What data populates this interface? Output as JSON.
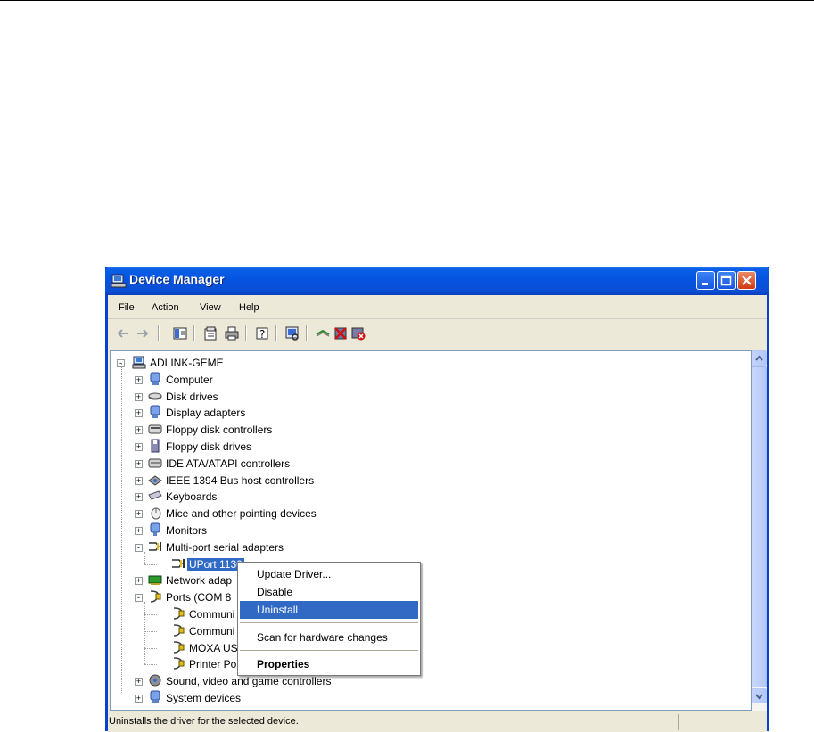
{
  "window": {
    "title": "Device Manager"
  },
  "menubar": {
    "items": [
      "File",
      "Action",
      "View",
      "Help"
    ]
  },
  "toolbar": {
    "icons": [
      "back-arrow-icon",
      "forward-arrow-icon",
      "show-hide-tree-icon",
      "properties-icon",
      "print-icon",
      "help-icon",
      "scan-hardware-icon",
      "update-driver-icon",
      "disable-device-icon",
      "uninstall-device-icon"
    ]
  },
  "tree": {
    "root": "ADLINK-GEME",
    "items": [
      "Computer",
      "Disk drives",
      "Display adapters",
      "Floppy disk controllers",
      "Floppy disk drives",
      "IDE ATA/ATAPI controllers",
      "IEEE 1394 Bus host controllers",
      "Keyboards",
      "Mice and other pointing devices",
      "Monitors",
      "Multi-port serial adapters",
      "UPort 1130",
      "Network adap",
      "Ports (COM 8",
      "Communi",
      "Communi",
      "MOXA US",
      "Printer Po",
      "Sound, video and game controllers",
      "System devices"
    ],
    "selected": "UPort 1130"
  },
  "context_menu": {
    "items": [
      "Update Driver...",
      "Disable",
      "Uninstall",
      "Scan for hardware changes",
      "Properties"
    ],
    "highlighted": "Uninstall"
  },
  "status": {
    "text": "Uninstalls the driver for the selected device."
  },
  "colors": {
    "title_blue": "#0553e0",
    "selection": "#316ac5",
    "chrome": "#ece9d8"
  }
}
